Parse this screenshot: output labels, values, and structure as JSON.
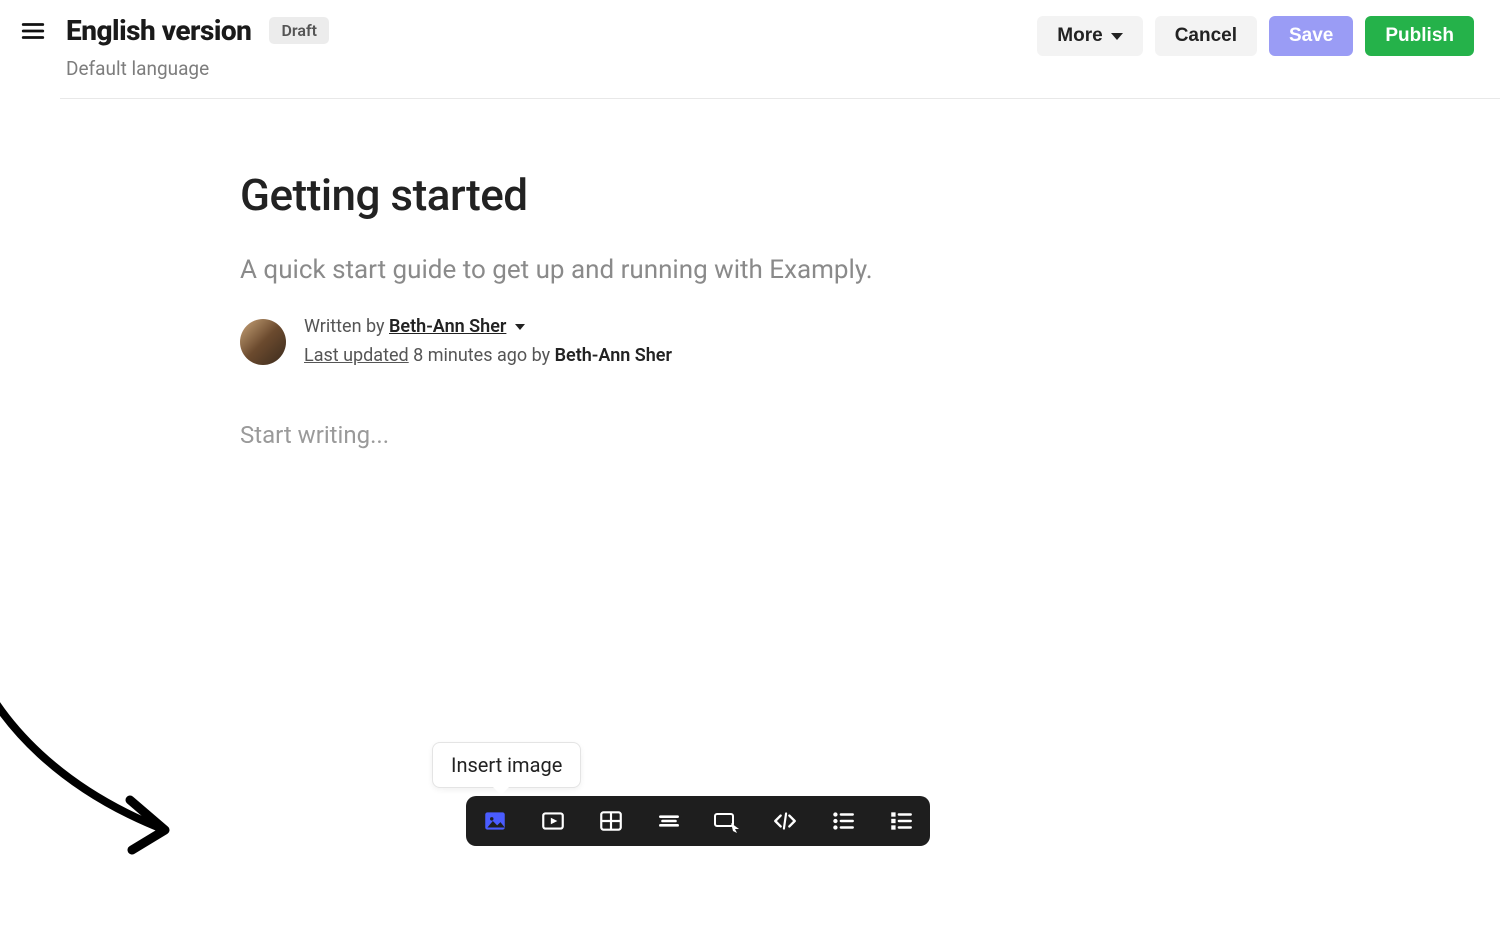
{
  "header": {
    "title": "English version",
    "badge": "Draft",
    "subtitle": "Default language",
    "actions": {
      "more": "More",
      "cancel": "Cancel",
      "save": "Save",
      "publish": "Publish"
    }
  },
  "document": {
    "title": "Getting started",
    "description": "A quick start guide to get up and running with Examply.",
    "written_by_label": "Written by",
    "author": "Beth-Ann Sher",
    "updated_label": "Last updated",
    "updated_time": "8 minutes ago",
    "updated_by_label": "by",
    "updated_by": "Beth-Ann Sher",
    "placeholder": "Start writing..."
  },
  "tooltip": "Insert image",
  "toolbar_icons": {
    "image": "image-icon",
    "video": "video-icon",
    "table": "table-icon",
    "divider": "divider-icon",
    "button": "button-icon",
    "code": "code-icon",
    "bulleted": "bulleted-list-icon",
    "numbered": "numbered-list-icon"
  },
  "colors": {
    "save": "#9a9cf5",
    "publish": "#25b24a",
    "toolbar_bg": "#1e1e1e",
    "accent_icon": "#4a5cff"
  }
}
